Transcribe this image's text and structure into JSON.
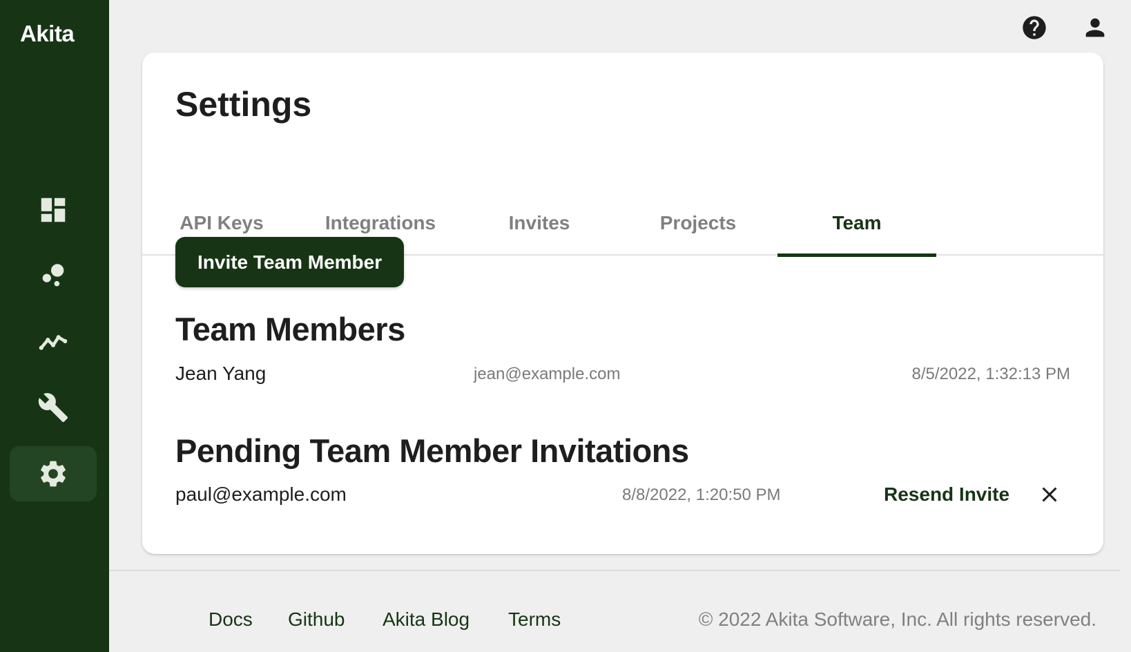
{
  "app": {
    "logo_text": "Akita",
    "sidebar": [
      {
        "name": "dashboard",
        "icon": "dashboard-icon",
        "active": false
      },
      {
        "name": "bubbles",
        "icon": "bubble-chart-icon",
        "active": false
      },
      {
        "name": "metrics",
        "icon": "line-chart-icon",
        "active": false
      },
      {
        "name": "tools",
        "icon": "wrench-icon",
        "active": false
      },
      {
        "name": "settings",
        "icon": "gear-icon",
        "active": true
      }
    ],
    "topbar": {
      "help_icon": "help-icon",
      "account_icon": "account-icon"
    }
  },
  "settings": {
    "title": "Settings",
    "tabs": [
      {
        "label": "API Keys",
        "active": false
      },
      {
        "label": "Integrations",
        "active": false
      },
      {
        "label": "Invites",
        "active": false
      },
      {
        "label": "Projects",
        "active": false
      },
      {
        "label": "Team",
        "active": true
      }
    ],
    "invite_button": "Invite Team Member",
    "team_members": {
      "title": "Team Members",
      "rows": [
        {
          "name": "Jean Yang",
          "email": "jean@example.com",
          "date": "8/5/2022, 1:32:13 PM"
        }
      ]
    },
    "pending": {
      "title": "Pending Team Member Invitations",
      "rows": [
        {
          "email": "paul@example.com",
          "date": "8/8/2022, 1:20:50 PM",
          "resend_label": "Resend Invite",
          "remove_icon": "close-icon"
        }
      ]
    }
  },
  "footer": {
    "links": [
      "Docs",
      "Github",
      "Akita Blog",
      "Terms"
    ],
    "copyright": "© 2022 Akita Software, Inc. All rights reserved."
  },
  "colors": {
    "sidebar_bg": "#173515",
    "accent": "#173515",
    "page_bg": "#efefef",
    "icon_light": "#e4eadf"
  }
}
